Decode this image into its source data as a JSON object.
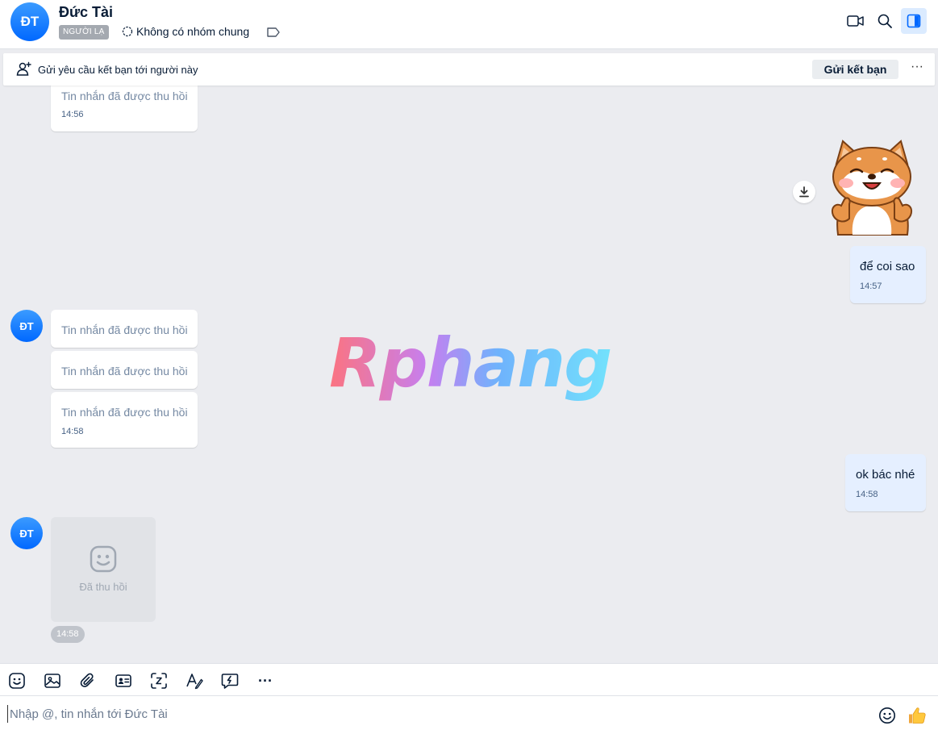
{
  "header": {
    "avatar_initials": "ĐT",
    "contact_name": "Đức Tài",
    "stranger_badge": "NGƯỜI LẠ",
    "common_group": "Không có nhóm chung",
    "icons": [
      "video-call-icon",
      "search-icon",
      "sidebar-toggle-icon"
    ]
  },
  "friend_request_bar": {
    "text": "Gửi yêu cầu kết bạn tới người này",
    "button": "Gửi kết bạn",
    "more": "···"
  },
  "messages": {
    "m1": {
      "text": "Tin nhắn đã được thu hồi",
      "time": "14:56"
    },
    "m2": {
      "text": "để coi sao",
      "time": "14:57"
    },
    "m3": {
      "text": "Tin nhắn đã được thu hồi"
    },
    "m4": {
      "text": "Tin nhắn đã được thu hồi"
    },
    "m5": {
      "text": "Tin nhắn đã được thu hồi",
      "time": "14:58"
    },
    "m6": {
      "text": "ok bác nhé",
      "time": "14:58"
    },
    "m7": {
      "text": "Đã thu hồi",
      "time": "14:58"
    },
    "avatar_initials": "ĐT"
  },
  "watermark": "Rphang",
  "toolbar": {
    "icons": [
      "sticker-icon",
      "image-icon",
      "attachment-icon",
      "contact-card-icon",
      "screenshot-icon",
      "text-format-icon",
      "quick-message-icon",
      "more-icon"
    ],
    "more_label": "···"
  },
  "composer": {
    "placeholder": "Nhập @, tin nhắn tới Đức Tài",
    "icons": [
      "emoji-icon",
      "thumbs-up-icon"
    ]
  },
  "colors": {
    "accent": "#0068ff",
    "chat_background": "#ebecf0",
    "my_bubble": "#e5efff",
    "stranger_badge": "#a4a9b0"
  }
}
